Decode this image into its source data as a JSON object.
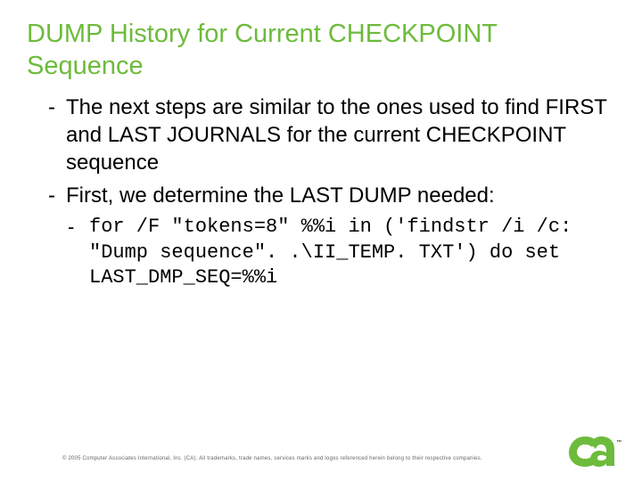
{
  "title": "DUMP History for Current CHECKPOINT Sequence",
  "bullets": {
    "b0": "The next steps are similar to the ones used to find FIRST and LAST JOURNALS for the current CHECKPOINT sequence",
    "b1": "First, we determine the LAST DUMP needed:",
    "code": "for /F \"tokens=8\" %%i in ('findstr /i /c: \"Dump sequence\". .\\II_TEMP. TXT') do set LAST_DMP_SEQ=%%i"
  },
  "footer": "© 2005 Computer Associates International, Inc. (CA). All trademarks, trade names, services marks and logos referenced herein belong to their respective companies.",
  "logo_name": "ca-logo"
}
